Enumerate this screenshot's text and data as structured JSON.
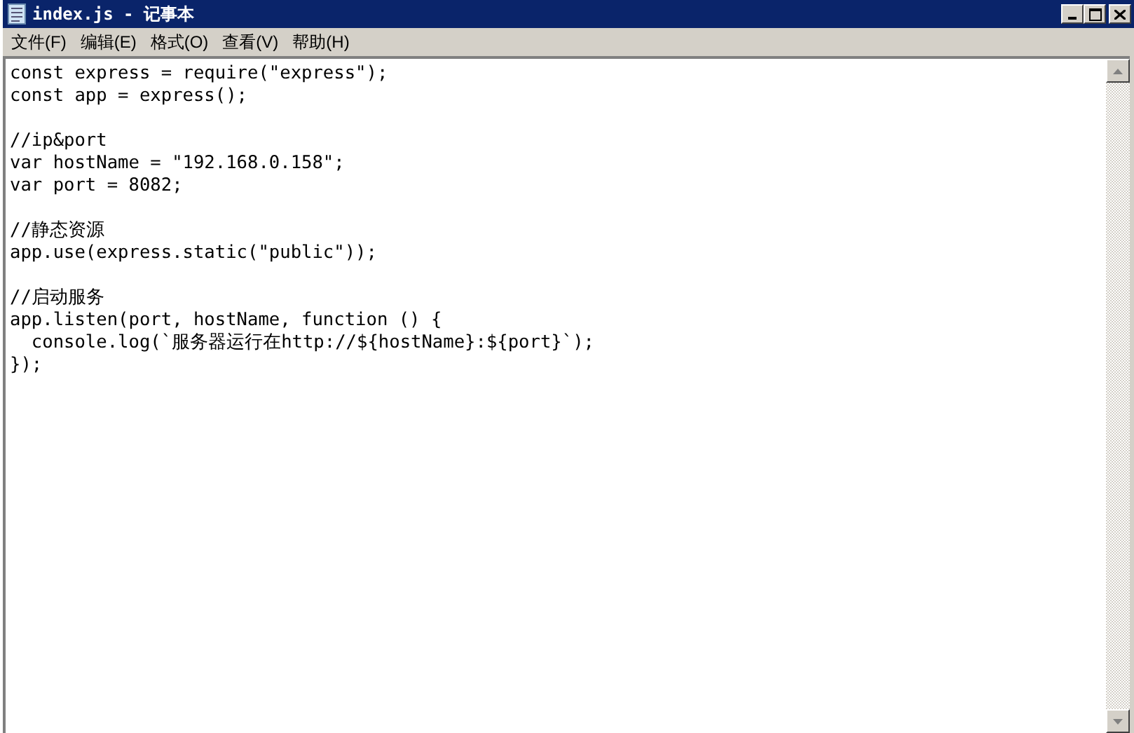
{
  "window": {
    "title": "index.js - 记事本"
  },
  "menu": [
    "文件(F)",
    "编辑(E)",
    "格式(O)",
    "查看(V)",
    "帮助(H)"
  ],
  "editor": {
    "text": "const express = require(\"express\");\nconst app = express();\n\n//ip&port\nvar hostName = \"192.168.0.158\";\nvar port = 8082;\n\n//静态资源\napp.use(express.static(\"public\"));\n\n//启动服务\napp.listen(port, hostName, function () {\n  console.log(`服务器运行在http://${hostName}:${port}`);\n});"
  }
}
